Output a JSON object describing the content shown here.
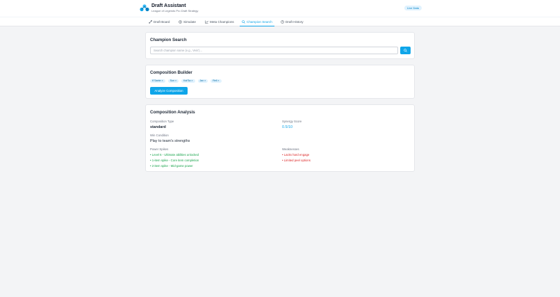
{
  "header": {
    "title": "Draft Assistant",
    "subtitle": "League of Legends Pro Draft Strategy",
    "patch": "Live Data"
  },
  "nav": {
    "tabs": [
      {
        "label": "Draft Board",
        "icon": "sword-icon",
        "active": false
      },
      {
        "label": "Simulate",
        "icon": "target-icon",
        "active": false
      },
      {
        "label": "Meta Champions",
        "icon": "chart-icon",
        "active": false
      },
      {
        "label": "Champion Search",
        "icon": "search-icon",
        "active": true
      },
      {
        "label": "Draft History",
        "icon": "history-icon",
        "active": false
      }
    ]
  },
  "search": {
    "title": "Champion Search",
    "placeholder": "Search champion name (e.g., Vein')..."
  },
  "builder": {
    "title": "Composition Builder",
    "chips": [
      "K'Sante",
      "Sun",
      "Kai'Sa",
      "Jax",
      "Rell"
    ],
    "remove_symbol": "×",
    "analyze_label": "Analyze Composition"
  },
  "analysis": {
    "title": "Composition Analysis",
    "type_label": "Composition Type",
    "type_value": "standard",
    "synergy_label": "Synergy Score",
    "synergy_value": "0.5/10",
    "win_label": "Win Condition",
    "win_value": "Play to team's strengths",
    "power_label": "Power Spikes",
    "power_spikes": [
      "• Level 6 - Ultimate abilities unlocked",
      "• 1-item spike - Core item completion",
      "• 2-item spike - Mid-game power"
    ],
    "weak_label": "Weaknesses",
    "weaknesses": [
      "• Lacks hard engage",
      "• Limited peel options"
    ]
  },
  "colors": {
    "accent": "#0ea5e9",
    "positive": "#16a34a",
    "negative": "#dc2626"
  }
}
